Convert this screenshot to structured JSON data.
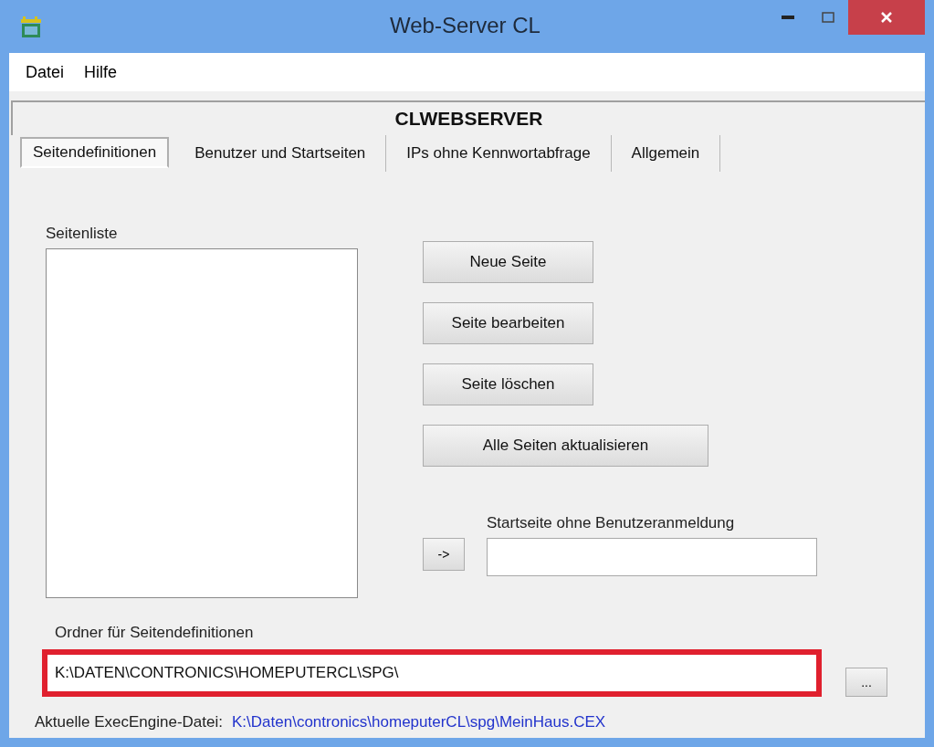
{
  "window": {
    "title": "Web-Server CL"
  },
  "menu": [
    "Datei",
    "Hilfe"
  ],
  "header": "CLWEBSERVER",
  "tabs": [
    {
      "label": "Seitendefinitionen",
      "selected": true
    },
    {
      "label": "Benutzer und Startseiten",
      "selected": false
    },
    {
      "label": "IPs ohne Kennwortabfrage",
      "selected": false
    },
    {
      "label": "Allgemein",
      "selected": false
    }
  ],
  "page_list": {
    "label": "Seitenliste"
  },
  "buttons": [
    {
      "label": "Neue Seite",
      "wide": false
    },
    {
      "label": "Seite bearbeiten",
      "wide": false
    },
    {
      "label": "Seite löschen",
      "wide": false
    },
    {
      "label": "Alle Seiten aktualisieren",
      "wide": true
    }
  ],
  "arrow_button": "->",
  "start_page": {
    "label": "Startseite ohne Benutzeranmeldung"
  },
  "folder": {
    "label": "Ordner für Seitendefinitionen",
    "value": "K:\\DATEN\\CONTRONICS\\HOMEPUTERCL\\SPG\\",
    "highlighted": true,
    "browse_button": "..."
  },
  "exec_engine": {
    "label": "Aktuelle ExecEngine-Datei:",
    "path": "K:\\Daten\\contronics\\homeputerCL\\spg\\MeinHaus.CEX"
  }
}
